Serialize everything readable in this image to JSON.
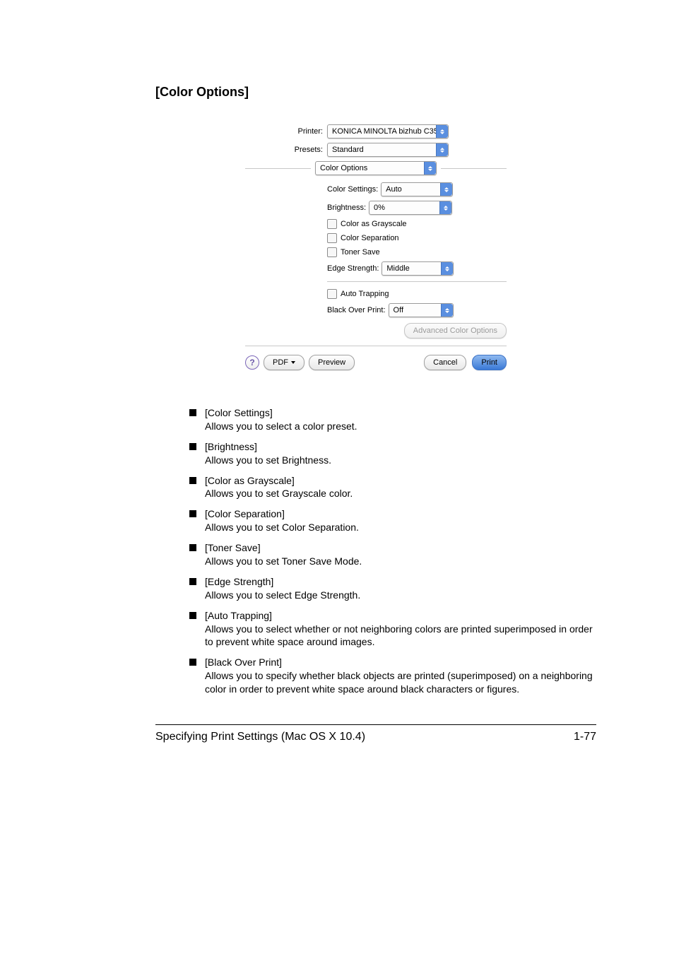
{
  "section_title": "[Color Options]",
  "dialog": {
    "printer_label": "Printer:",
    "printer_value": "KONICA MINOLTA bizhub C35...",
    "presets_label": "Presets:",
    "presets_value": "Standard",
    "pane_value": "Color Options",
    "color_settings_label": "Color Settings:",
    "color_settings_value": "Auto",
    "brightness_label": "Brightness:",
    "brightness_value": "0%",
    "ck_grayscale": "Color as Grayscale",
    "ck_separation": "Color Separation",
    "ck_tonersave": "Toner Save",
    "edge_strength_label": "Edge Strength:",
    "edge_strength_value": "Middle",
    "ck_autotrap": "Auto Trapping",
    "black_over_label": "Black Over Print:",
    "black_over_value": "Off",
    "advanced_btn": "Advanced Color Options",
    "help_glyph": "?",
    "pdf_btn": "PDF",
    "preview_btn": "Preview",
    "cancel_btn": "Cancel",
    "print_btn": "Print"
  },
  "descriptions": [
    {
      "title": "[Color Settings]",
      "body": "Allows you to select a color preset."
    },
    {
      "title": "[Brightness]",
      "body": "Allows you to set Brightness."
    },
    {
      "title": "[Color as Grayscale]",
      "body": "Allows you to set Grayscale color."
    },
    {
      "title": "[Color Separation]",
      "body": "Allows you to set Color Separation."
    },
    {
      "title": "[Toner Save]",
      "body": "Allows you to set Toner Save Mode."
    },
    {
      "title": "[Edge Strength]",
      "body": "Allows you to select Edge Strength."
    },
    {
      "title": "[Auto Trapping]",
      "body": "Allows you to select whether or not neighboring colors are printed superimposed in order to prevent white space around images."
    },
    {
      "title": "[Black Over Print]",
      "body": "Allows you to specify whether black objects are printed (superimposed) on a neighboring color in order to prevent white space around black characters or figures."
    }
  ],
  "footer": {
    "title": "Specifying Print Settings (Mac OS X 10.4)",
    "page": "1-77"
  }
}
